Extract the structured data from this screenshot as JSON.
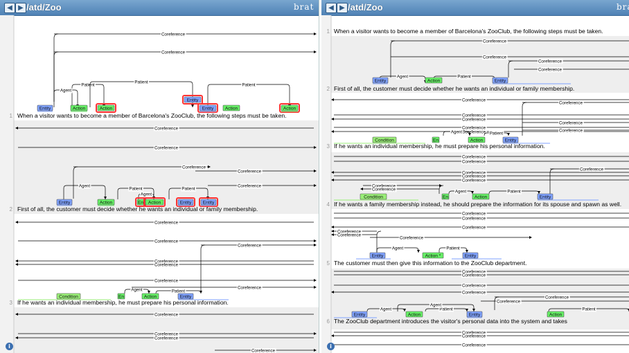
{
  "app": {
    "breadcrumb": "/atd/Zoo",
    "logo": "brat"
  },
  "colors": {
    "entity": "#7fa2ff",
    "action": "#66ee66",
    "condition": "#99ee77",
    "arc": "#000000",
    "highlight": "#ff3333"
  },
  "labels": {
    "entity": "Entity",
    "action": "Action",
    "action_star": "Action *",
    "en": "En",
    "condition": "Condition",
    "coref": "Coreference",
    "patient": "Patient",
    "agent": "Agent"
  },
  "left": {
    "sentences": [
      {
        "num": "1",
        "text": "When a visitor wants to become a member of Barcelona's ZooClub, the following steps must be taken."
      },
      {
        "num": "2",
        "text": "First of all, the customer must decide whether he wants an individual or family membership."
      },
      {
        "num": "3",
        "text": "If he wants an individual membership, he must prepare his personal information."
      }
    ]
  },
  "right": {
    "sentences": [
      {
        "num": "1",
        "text": "When a visitor wants to become a member of Barcelona's ZooClub, the following steps must be taken."
      },
      {
        "num": "2",
        "text": "First of all, the customer must decide whether he wants an individual or family membership."
      },
      {
        "num": "3",
        "text": "If he wants an individual membership, he must prepare his personal information."
      },
      {
        "num": "4",
        "text": "If he wants a family membership instead, he should prepare the information for its spouse and spawn as well."
      },
      {
        "num": "5",
        "text": "The customer must then give this information to the ZooClub department."
      },
      {
        "num": "6",
        "text": "The ZooClub department introduces the visitor's personal data into the system and takes"
      }
    ]
  }
}
